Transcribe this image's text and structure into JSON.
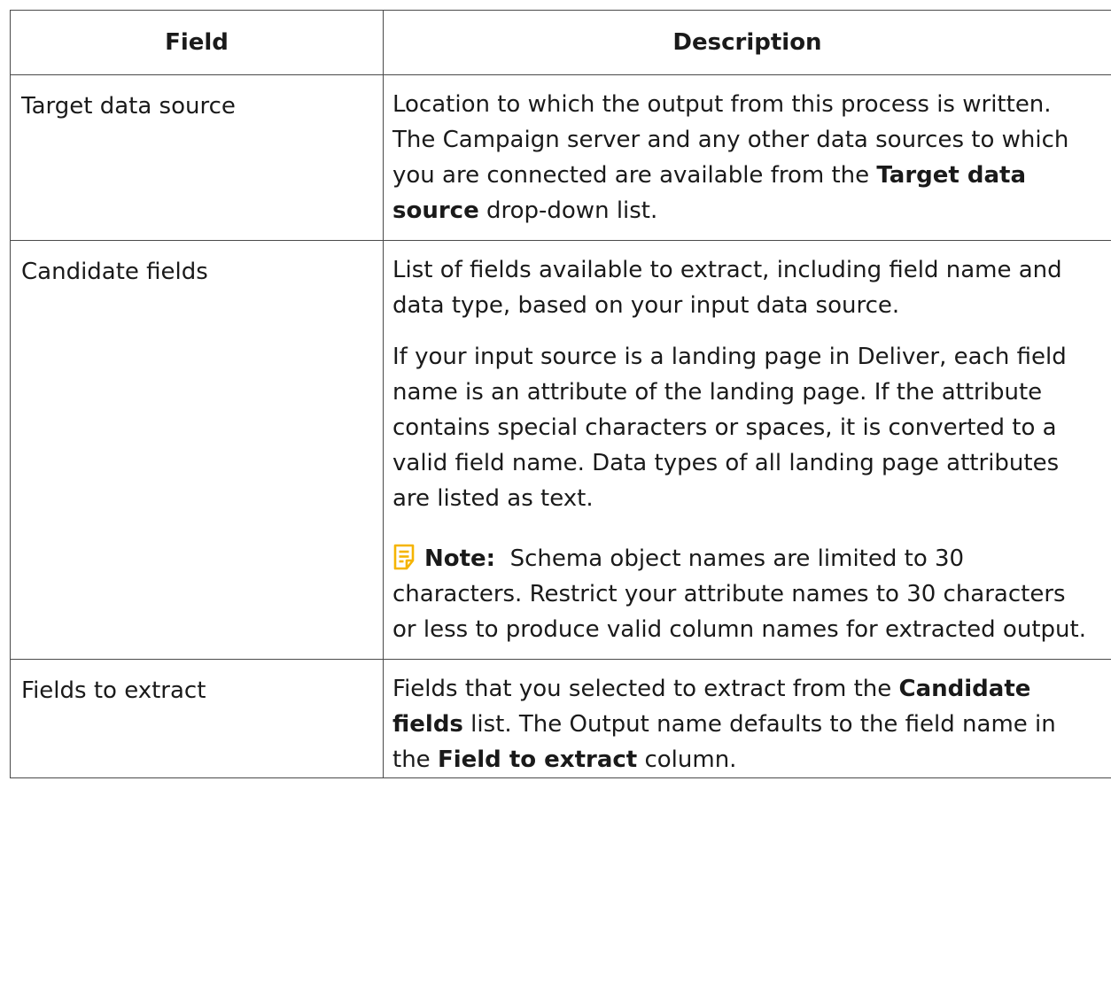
{
  "header": {
    "field": "Field",
    "description": "Description"
  },
  "rows": [
    {
      "field": "Target data source",
      "p1": {
        "t1": "Location to which the output from this process is written. The Campaign server and any other data sources to which you are connected are available from the ",
        "b1": "Target data source",
        "t2": " drop-down list."
      }
    },
    {
      "field": "Candidate fields",
      "p1": "List of fields available to extract, including field name and data type, based on your input data source.",
      "p2": "If your input source is a landing page in Deliver, each field name is an attribute of the landing page. If the attribute contains special characters or spaces, it is converted to a valid field name. Data types of all landing page attributes are listed as text.",
      "note": {
        "label": "Note:",
        "text": "Schema object names are limited to 30 characters. Restrict your attribute names to 30 characters or less to produce valid column names for extracted output.",
        "icon": "note-icon",
        "icon_color": "#f5b400"
      }
    },
    {
      "field": "Fields to extract",
      "p1": {
        "t1": "Fields that you selected to extract from the ",
        "b1": "Candidate fields",
        "t2": " list. The Output name defaults to the field name in the ",
        "b2": "Field to extract",
        "t3": " column."
      }
    }
  ]
}
